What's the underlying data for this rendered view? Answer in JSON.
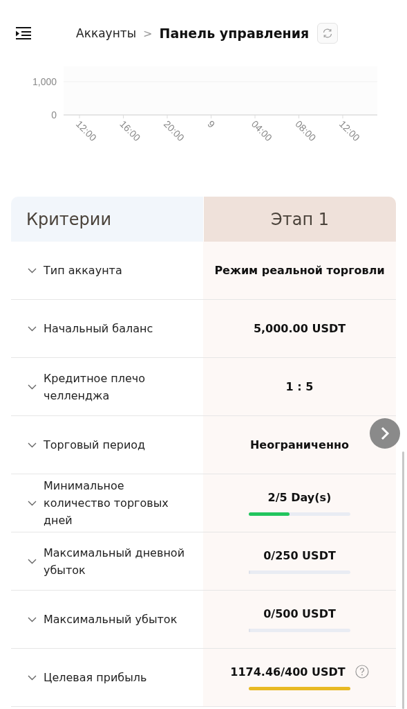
{
  "header": {
    "breadcrumb_parent": "Аккаунты",
    "separator": ">",
    "title": "Панель управления"
  },
  "chart": {
    "chart_data": {
      "type": "line",
      "categories": [
        "12:00",
        "16:00",
        "20:00",
        "9",
        "04:00",
        "08:00",
        "12:00"
      ],
      "yticks": [
        0,
        {
          "value": 1000,
          "label": "1,000"
        }
      ],
      "ylim": [
        0,
        1000
      ]
    }
  },
  "table": {
    "columns": [
      "Критерии",
      "Этап 1"
    ],
    "rows": [
      {
        "label": "Тип аккаунта",
        "value": "Режим реальной торговли",
        "kind": "text"
      },
      {
        "label": "Начальный баланс",
        "value": "5,000.00 USDT",
        "kind": "text"
      },
      {
        "label": "Кредитное плечо челленджа",
        "value": "1 : 5",
        "kind": "text"
      },
      {
        "label": "Торговый период",
        "value": "Неограниченно",
        "kind": "text"
      },
      {
        "label": "Минимальное количество торговых дней",
        "value": "2/5 Day(s)",
        "kind": "progress",
        "level": 0.4,
        "color": "#22c55e"
      },
      {
        "label": "Максимальный дневной убыток",
        "value": "0/250 USDT",
        "kind": "progress",
        "level": 0
      },
      {
        "label": "Максимальный убыток",
        "value": "0/500 USDT",
        "kind": "progress",
        "level": 0
      },
      {
        "label": "Целевая прибыль",
        "value": "1174.46/400 USDT",
        "kind": "progress",
        "level": 1,
        "color": "#e8b923",
        "help": true
      }
    ]
  }
}
